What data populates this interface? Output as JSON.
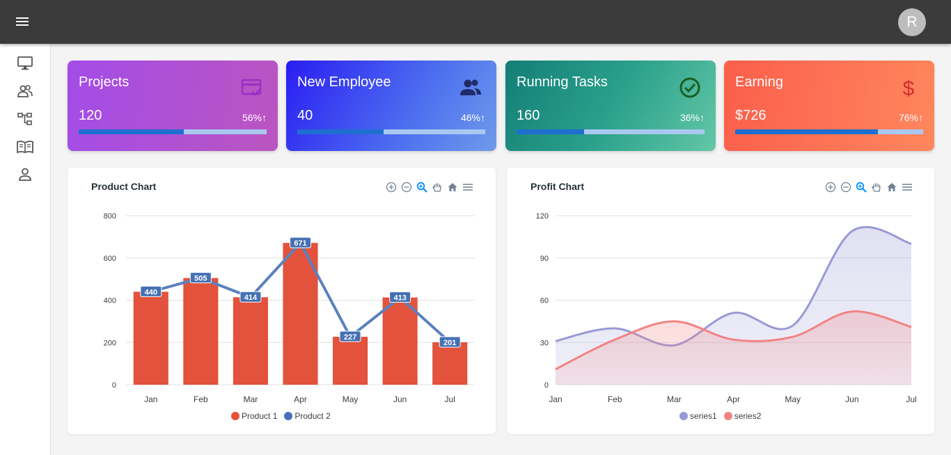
{
  "user": {
    "avatar_initial": "R"
  },
  "cards": [
    {
      "title": "Projects",
      "value": "120",
      "percent": "56%",
      "progress": 0.56,
      "icon": "card-check-icon",
      "icon_color": "#9a2fc4"
    },
    {
      "title": "New Employee",
      "value": "40",
      "percent": "46%",
      "progress": 0.46,
      "icon": "users-icon",
      "icon_color": "#1f2a66"
    },
    {
      "title": "Running Tasks",
      "value": "160",
      "percent": "36%",
      "progress": 0.36,
      "icon": "check-circle-icon",
      "icon_color": "#1b5e20"
    },
    {
      "title": "Earning",
      "value": "$726",
      "percent": "76%",
      "progress": 0.76,
      "icon": "dollar-icon",
      "icon_color": "#d32f2f"
    }
  ],
  "colors": {
    "bar": "#e2523c",
    "line": "#5b81bd",
    "label_bg": "#4571b4",
    "series1": "#9999d6",
    "series2": "#f28383"
  },
  "chart_data": [
    {
      "type": "bar",
      "title": "Product Chart",
      "categories": [
        "Jan",
        "Feb",
        "Mar",
        "Apr",
        "May",
        "Jun",
        "Jul"
      ],
      "series": [
        {
          "name": "Product 1",
          "type": "bar",
          "values": [
            440,
            505,
            414,
            671,
            227,
            413,
            201
          ]
        },
        {
          "name": "Product 2",
          "type": "line",
          "values": [
            440,
            505,
            414,
            671,
            227,
            413,
            201
          ]
        }
      ],
      "ylim": [
        0,
        800
      ],
      "yticks": [
        0,
        200,
        400,
        600,
        800
      ],
      "grid": true,
      "legend": "bottom"
    },
    {
      "type": "area",
      "title": "Profit Chart",
      "categories": [
        "Jan",
        "Feb",
        "Mar",
        "Apr",
        "May",
        "Jun",
        "Jul"
      ],
      "series": [
        {
          "name": "series1",
          "values": [
            31,
            40,
            28,
            51,
            42,
            109,
            100
          ]
        },
        {
          "name": "series2",
          "values": [
            11,
            32,
            45,
            32,
            34,
            52,
            41
          ]
        }
      ],
      "ylim": [
        0,
        120
      ],
      "yticks": [
        0,
        30,
        60,
        90,
        120
      ],
      "grid": true,
      "legend": "bottom"
    }
  ]
}
